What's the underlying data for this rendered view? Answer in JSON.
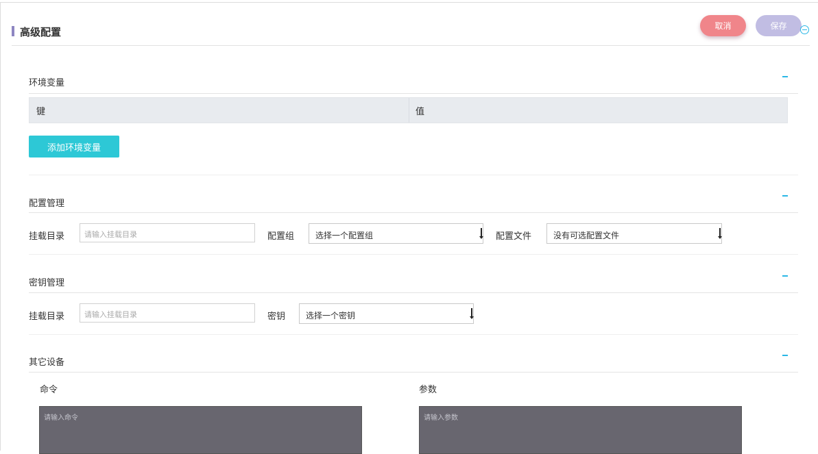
{
  "header": {
    "title": "高级配置",
    "cancel_label": "取消",
    "save_label": "保存"
  },
  "colors": {
    "accent": "#29b7e6",
    "cancel": "#f0858a",
    "save": "#c1bde3",
    "add_button": "#2dc8d6",
    "title_marker": "#8e86c2",
    "textarea_bg": "#68666f"
  },
  "env": {
    "title": "环境变量",
    "columns": [
      "键",
      "值"
    ],
    "add_label": "添加环境变量"
  },
  "config": {
    "title": "配置管理",
    "mount_label": "挂载目录",
    "mount_placeholder": "请输入挂载目录",
    "group_label": "配置组",
    "group_value": "选择一个配置组",
    "file_label": "配置文件",
    "file_value": "没有可选配置文件"
  },
  "secret": {
    "title": "密钥管理",
    "mount_label": "挂载目录",
    "mount_placeholder": "请输入挂载目录",
    "key_label": "密钥",
    "key_value": "选择一个密钥"
  },
  "other": {
    "title": "其它设备",
    "command_label": "命令",
    "command_placeholder": "请输入命令",
    "args_label": "参数",
    "args_placeholder": "请输入参数"
  }
}
